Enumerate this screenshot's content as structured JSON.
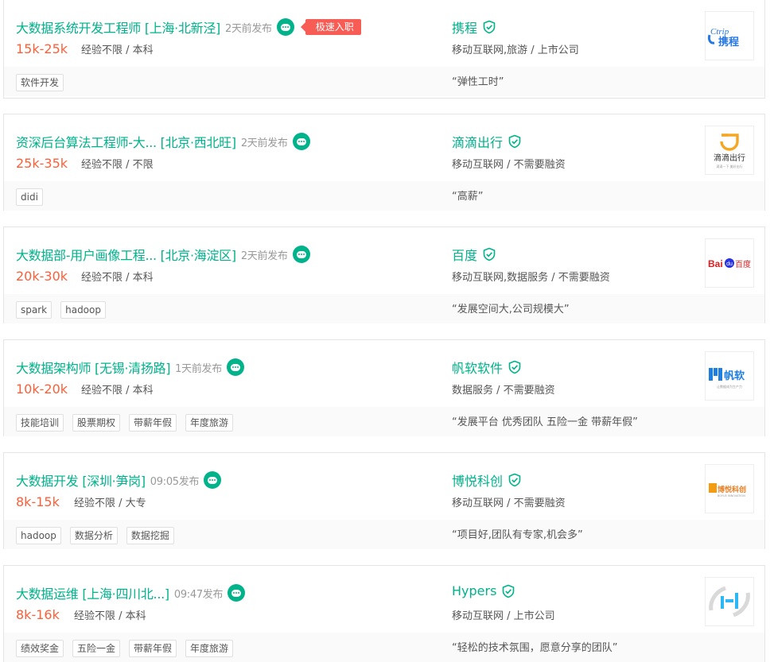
{
  "colors": {
    "accent": "#00b38a",
    "salary": "#fd5f39",
    "badge": "#f75c55"
  },
  "jobs": [
    {
      "title": "大数据系统开发工程师",
      "location": "[上海·北新泾]",
      "published": "2天前发布",
      "fast_badge": "极速入职",
      "salary": "15k-25k",
      "requirements": "经验不限 / 本科",
      "company": "携程",
      "industry": "移动互联网,旅游 / 上市公司",
      "tags": [
        "软件开发"
      ],
      "benefit": "“弹性工时”",
      "logo": {
        "line1": "Ctrip",
        "line2": "携程"
      }
    },
    {
      "title": "资深后台算法工程师-大...",
      "location": "[北京·西北旺]",
      "published": "2天前发布",
      "salary": "25k-35k",
      "requirements": "经验不限 / 不限",
      "company": "滴滴出行",
      "industry": "移动互联网 / 不需要融资",
      "tags": [
        "didi"
      ],
      "benefit": "“高薪”",
      "logo": {
        "line1": "滴滴出行",
        "line2": "滴滴一下 美好出行"
      }
    },
    {
      "title": "大数据部-用户画像工程...",
      "location": "[北京·海淀区]",
      "published": "2天前发布",
      "salary": "20k-30k",
      "requirements": "经验不限 / 本科",
      "company": "百度",
      "industry": "移动互联网,数据服务 / 不需要融资",
      "tags": [
        "spark",
        "hadoop"
      ],
      "benefit": "“发展空间大,公司规模大”",
      "logo": {
        "line1": "Bai",
        "line2": "du",
        "line3": "百度"
      }
    },
    {
      "title": "大数据架构师",
      "location": "[无锡·清扬路]",
      "published": "1天前发布",
      "salary": "10k-20k",
      "requirements": "经验不限 / 本科",
      "company": "帆软软件",
      "industry": "数据服务 / 不需要融资",
      "tags": [
        "技能培训",
        "股票期权",
        "带薪年假",
        "年度旅游"
      ],
      "benefit": "“发展平台 优秀团队 五险一金 带薪年假”",
      "logo": {
        "line1": "帆软",
        "line2": "让数据成为生产力"
      }
    },
    {
      "title": "大数据开发",
      "location": "[深圳·笋岗]",
      "published": "09:05发布",
      "salary": "8k-15k",
      "requirements": "经验不限 / 大专",
      "company": "博悦科创",
      "industry": "移动互联网 / 不需要融资",
      "tags": [
        "hadoop",
        "数据分析",
        "数据挖掘"
      ],
      "benefit": "“项目好,团队有专家,机会多”",
      "logo": {
        "line1": "博悦科创",
        "line2": "BOYUE INNOVATION"
      }
    },
    {
      "title": "大数据运维",
      "location": "[上海·四川北...]",
      "published": "09:47发布",
      "salary": "8k-16k",
      "requirements": "经验不限 / 本科",
      "company": "Hypers",
      "industry": "移动互联网 / 上市公司",
      "tags": [
        "绩效奖金",
        "五险一金",
        "带薪年假",
        "年度旅游"
      ],
      "benefit": "“轻松的技术氛围，愿意分享的团队”",
      "logo": {
        "line1": ""
      }
    }
  ]
}
